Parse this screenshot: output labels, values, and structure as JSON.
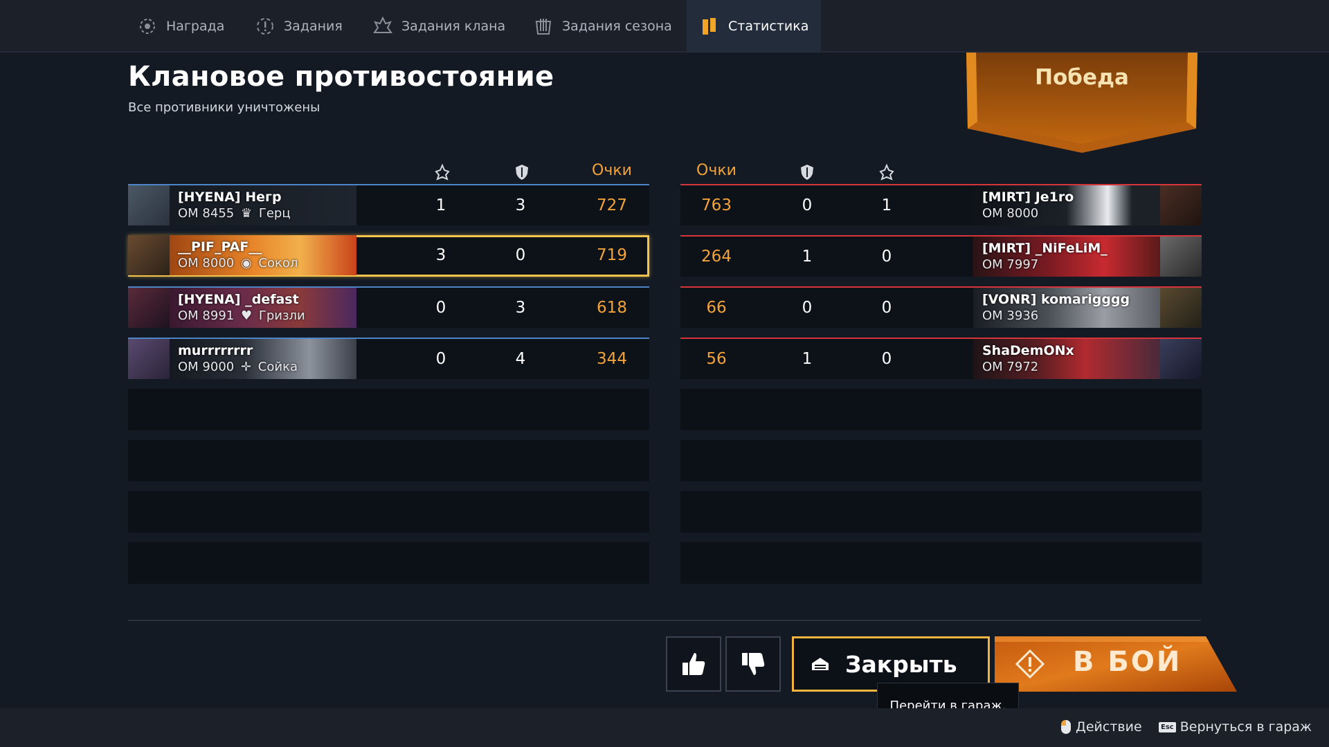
{
  "tabs": [
    {
      "label": "Награда",
      "icon": "reward-icon",
      "active": false
    },
    {
      "label": "Задания",
      "icon": "tasks-icon",
      "active": false
    },
    {
      "label": "Задания клана",
      "icon": "clan-tasks-icon",
      "active": false
    },
    {
      "label": "Задания сезона",
      "icon": "season-tasks-icon",
      "active": false
    },
    {
      "label": "Статистика",
      "icon": "statistics-icon",
      "active": true
    }
  ],
  "header": {
    "title": "Клановое противостояние",
    "subtitle": "Все противники уничтожены",
    "result": "Победа"
  },
  "columns": {
    "kills_icon": "kills-icon",
    "assists_icon": "shield-icon",
    "points": "Очки"
  },
  "team_left": [
    {
      "name": "[HYENA] Негр",
      "om": "ОМ 8455",
      "vehicle": "Герц",
      "vehicle_icon": "crown-icon",
      "kills": "1",
      "assists": "3",
      "points": "727",
      "highlight": false,
      "banner": "dark"
    },
    {
      "name": "__PIF_PAF__",
      "om": "ОМ 8000",
      "vehicle": "Сокол",
      "vehicle_icon": "cycle-icon",
      "kills": "3",
      "assists": "0",
      "points": "719",
      "highlight": true,
      "banner": "orange"
    },
    {
      "name": "[HYENA] _defast",
      "om": "ОМ 8991",
      "vehicle": "Гризли",
      "vehicle_icon": "bear-icon",
      "kills": "0",
      "assists": "3",
      "points": "618",
      "highlight": false,
      "banner": "purple"
    },
    {
      "name": "murrrrrrrr",
      "om": "ОМ 9000",
      "vehicle": "Сойка",
      "vehicle_icon": "crosshair-icon",
      "kills": "0",
      "assists": "4",
      "points": "344",
      "highlight": false,
      "banner": "lightning"
    }
  ],
  "team_right": [
    {
      "name": "[MIRT] Je1ro",
      "om": "ОМ 8000",
      "points": "763",
      "assists": "0",
      "kills": "1",
      "banner": "hands"
    },
    {
      "name": "[MIRT] _NiFeLiM_",
      "om": "ОМ 7997",
      "points": "264",
      "assists": "1",
      "kills": "0",
      "banner": "red"
    },
    {
      "name": "[VONR] komarigggg",
      "om": "ОМ 3936",
      "points": "66",
      "assists": "0",
      "kills": "0",
      "banner": "grey"
    },
    {
      "name": "ShaDemONx",
      "om": "ОМ 7972",
      "points": "56",
      "assists": "1",
      "kills": "0",
      "banner": "crimson"
    }
  ],
  "buttons": {
    "like_icon": "thumbs-up-icon",
    "dislike_icon": "thumbs-down-icon",
    "close_label": "Закрыть",
    "close_icon": "garage-icon",
    "fight_label": "В БОЙ",
    "fight_icon": "battle-icon"
  },
  "tooltip": "Перейти в гараж.",
  "footer": {
    "action_label": "Действие",
    "action_icon": "mouse-icon",
    "esc_key": "Esc",
    "back_label": "Вернуться в гараж"
  },
  "colors": {
    "accent": "#f2a33a",
    "ally": "#4c86c8",
    "enemy": "#d8353b",
    "highlight": "#f6c44c"
  }
}
